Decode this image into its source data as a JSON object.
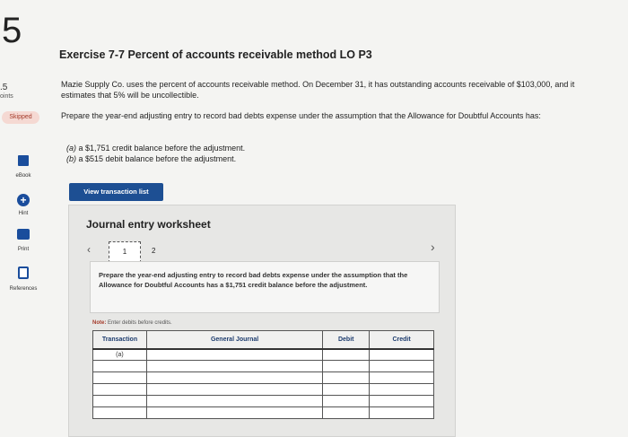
{
  "question": {
    "number": "5",
    "points_value": ".5",
    "points_label": "oints",
    "status": "Skipped"
  },
  "tools": [
    {
      "label": "eBook",
      "icon": "ebook-icon"
    },
    {
      "label": "Hint",
      "icon": "hint-icon"
    },
    {
      "label": "Print",
      "icon": "print-icon"
    },
    {
      "label": "References",
      "icon": "references-icon"
    }
  ],
  "exercise": {
    "title": "Exercise 7-7 Percent of accounts receivable method LO P3",
    "prompt": "Mazie Supply Co. uses the percent of accounts receivable method. On December 31, it has outstanding accounts receivable of $103,000, and it estimates that 5% will be uncollectible.",
    "instruction": "Prepare the year-end adjusting entry to record bad debts expense under the assumption that the Allowance for Doubtful Accounts has:",
    "part_a_label": "(a)",
    "part_a_text": " a $1,751 credit balance before the adjustment.",
    "part_b_label": "(b)",
    "part_b_text": " a $515 debit balance before the adjustment."
  },
  "view_transaction_button": "View transaction list",
  "worksheet": {
    "title": "Journal entry worksheet",
    "page_current": "1",
    "page_next": "2",
    "description": "Prepare the year-end adjusting entry to record bad debts expense under the assumption that the Allowance for Doubtful Accounts has a $1,751 credit balance before the adjustment.",
    "note_label": "Note:",
    "note_text": " Enter debits before credits.",
    "columns": [
      "Transaction",
      "General Journal",
      "Debit",
      "Credit"
    ],
    "first_transaction": "(a)"
  },
  "colors": {
    "accent": "#1d4f93",
    "skipped_bg": "#f5d9d3",
    "skipped_text": "#a43a2a"
  }
}
